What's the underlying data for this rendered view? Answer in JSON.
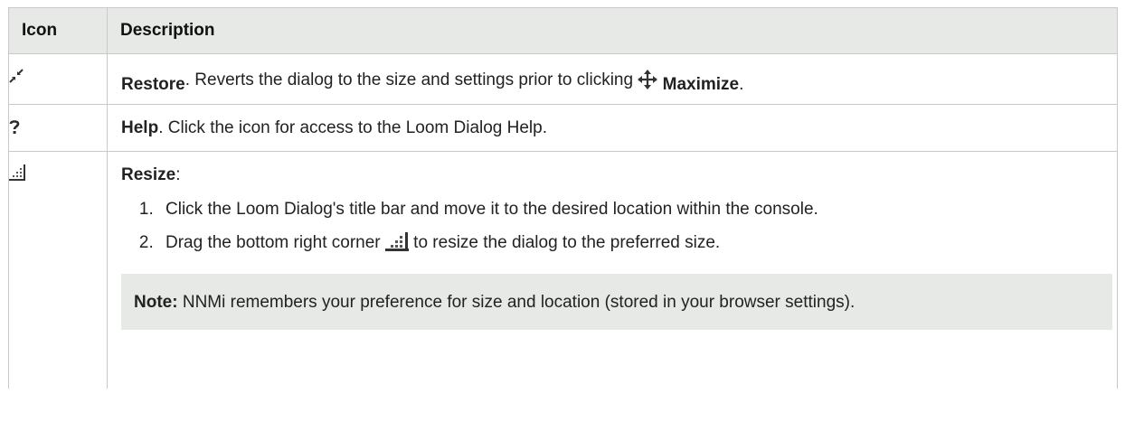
{
  "table": {
    "headers": [
      "Icon",
      "Description"
    ],
    "rows": [
      {
        "icon": "restore-icon",
        "title": "Restore",
        "text": ". Reverts the dialog to the size and settings prior to clicking ",
        "inline_icon": "maximize-icon",
        "link": "Maximize",
        "end": "."
      },
      {
        "icon": "help-icon",
        "title": "Help",
        "text": ". Click the icon for access to the Loom Dialog Help."
      },
      {
        "icon": "resize-grip-icon",
        "title": "Resize",
        "title_suffix": ":",
        "steps": [
          "Click the Loom Dialog's title bar and move it to the desired location within the console.",
          {
            "before": "Drag the bottom right corner ",
            "icon": "resize-grip-icon",
            "after": " to resize the dialog to the preferred size."
          }
        ],
        "note_label": "Note:",
        "note_text": " NNMi remembers your preference for size and location (stored in your browser settings)."
      }
    ]
  }
}
